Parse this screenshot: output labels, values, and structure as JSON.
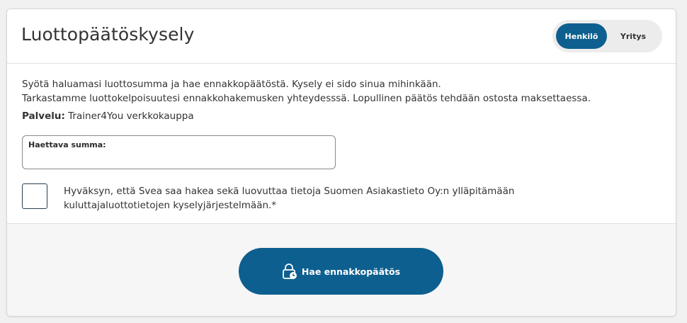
{
  "header": {
    "title": "Luottopäätöskysely",
    "toggle": {
      "options": [
        "Henkilö",
        "Yritys"
      ],
      "selected": "Henkilö"
    }
  },
  "intro": {
    "line1": "Syötä haluamasi luottosumma ja hae ennakkopäätöstä. Kysely ei sido sinua mihinkään.",
    "line2": "Tarkastamme luottokelpoisuutesi ennakkohakemusken yhteydesssä. Lopullinen päätös tehdään ostosta maksettaessa."
  },
  "service": {
    "label": "Palvelu:",
    "value": "Trainer4You verkkokauppa"
  },
  "amount_field": {
    "label": "Haettava summa:",
    "value": ""
  },
  "consent": {
    "checked": false,
    "line1": "Hyväksyn, että Svea saa hakea sekä luovuttaa tietoja Suomen Asiakastieto Oy:n ylläpitämään",
    "line2": "kuluttajaluottotietojen kyselyjärjestelmään.*"
  },
  "submit": {
    "label": "Hae ennakkopäätös",
    "icon": "lock-clock-icon"
  },
  "colors": {
    "primary": "#0d5f8f",
    "footer_bg": "#f6f6f6",
    "page_bg": "#f1f1f1"
  }
}
